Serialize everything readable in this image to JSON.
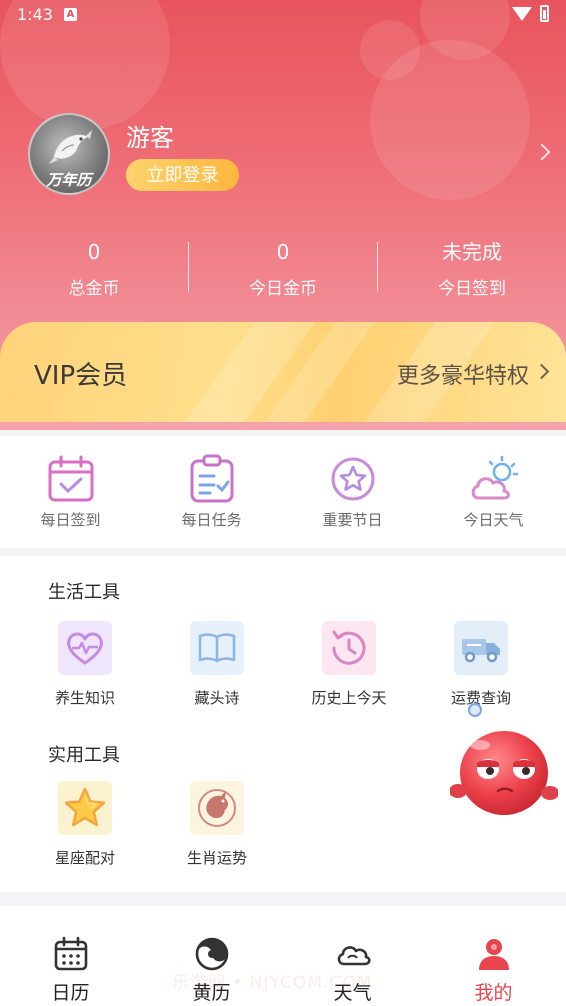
{
  "status_bar": {
    "time": "1:43",
    "notification_letter": "A"
  },
  "profile": {
    "username": "游客",
    "login_button": "立即登录",
    "avatar_text": "万年历"
  },
  "stats": [
    {
      "value": "0",
      "label": "总金币"
    },
    {
      "value": "0",
      "label": "今日金币"
    },
    {
      "value": "未完成",
      "label": "今日签到"
    }
  ],
  "vip": {
    "title": "VIP会员",
    "more": "更多豪华特权"
  },
  "quick_actions": [
    {
      "label": "每日签到",
      "icon": "calendar-check-icon"
    },
    {
      "label": "每日任务",
      "icon": "clipboard-task-icon"
    },
    {
      "label": "重要节日",
      "icon": "star-circle-icon"
    },
    {
      "label": "今日天气",
      "icon": "sun-cloud-icon"
    }
  ],
  "life_tools": {
    "title": "生活工具",
    "items": [
      {
        "label": "养生知识",
        "icon": "heart-pulse-icon"
      },
      {
        "label": "藏头诗",
        "icon": "book-icon"
      },
      {
        "label": "历史上今天",
        "icon": "history-clock-icon"
      },
      {
        "label": "运费查询",
        "icon": "truck-icon"
      }
    ]
  },
  "practical_tools": {
    "title": "实用工具",
    "items": [
      {
        "label": "星座配对",
        "icon": "star-icon"
      },
      {
        "label": "生肖运势",
        "icon": "dragon-icon"
      }
    ]
  },
  "watermark": "乐游网 • NJYCOM.COM",
  "bottom_nav": [
    {
      "label": "日历",
      "icon": "calendar-icon",
      "active": false
    },
    {
      "label": "黄历",
      "icon": "almanac-icon",
      "active": false
    },
    {
      "label": "天气",
      "icon": "cloud-icon",
      "active": false
    },
    {
      "label": "我的",
      "icon": "person-icon",
      "active": true
    }
  ],
  "colors": {
    "accent": "#e8454f",
    "hero_top": "#e8545d",
    "vip_gold": "#ffd37a",
    "login_button": "#ffb63d"
  }
}
